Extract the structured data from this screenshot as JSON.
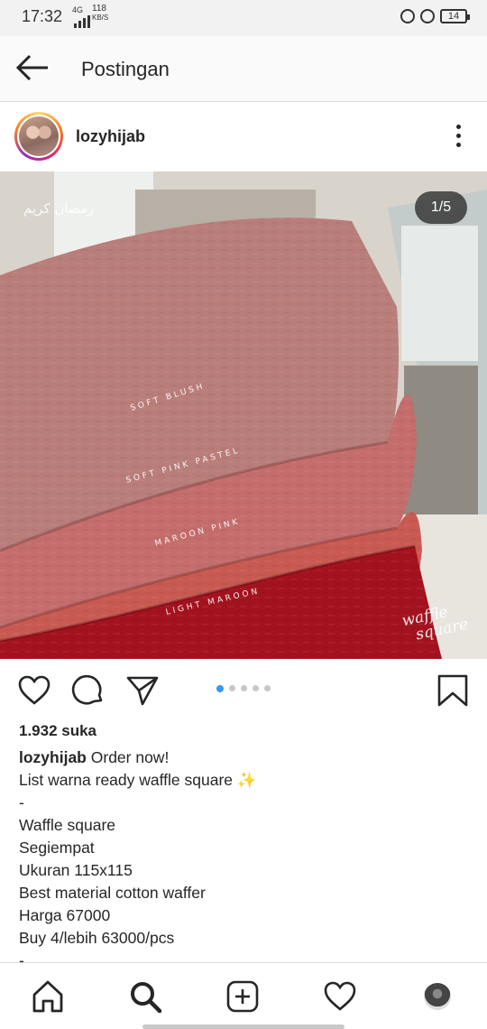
{
  "status_bar": {
    "time": "17:32",
    "network": "4G",
    "speed_value": "118",
    "speed_unit": "KB/S",
    "battery": "14"
  },
  "header": {
    "title": "Postingan",
    "back_icon": "arrow-left-icon"
  },
  "post": {
    "username": "lozyhijab",
    "more_icon": "more-vertical-icon",
    "image": {
      "page_indicator": "1/5",
      "overlay_arabic": "رمضان كريم",
      "labels": [
        "SOFT BLUSH",
        "SOFT PINK PASTEL",
        "MAROON PINK",
        "LIGHT MAROON"
      ],
      "watermark_line1": "waffle",
      "watermark_line2": "square",
      "colors": {
        "soft_blush": "#b97d7a",
        "soft_pink_pastel": "#c46d6c",
        "maroon_pink": "#c85a52",
        "light_maroon": "#a3121f"
      }
    },
    "carousel": {
      "total": 5,
      "active": 1,
      "active_color": "#3897f0"
    },
    "likes": "1.932 suka",
    "caption_username": "lozyhijab",
    "caption_lines": [
      "Order now!",
      "List warna ready waffle square ✨",
      "-",
      "Waffle square",
      "Segiempat",
      "Ukuran 115x115",
      "Best material cotton waffer",
      "Harga 67000",
      "Buy 4/lebih 63000/pcs",
      "-"
    ]
  },
  "actions": {
    "like_icon": "heart-icon",
    "comment_icon": "comment-icon",
    "share_icon": "paper-plane-icon",
    "save_icon": "bookmark-icon"
  },
  "bottom_nav": {
    "items": [
      "home-icon",
      "search-icon",
      "add-post-icon",
      "activity-heart-icon",
      "profile-avatar"
    ]
  }
}
